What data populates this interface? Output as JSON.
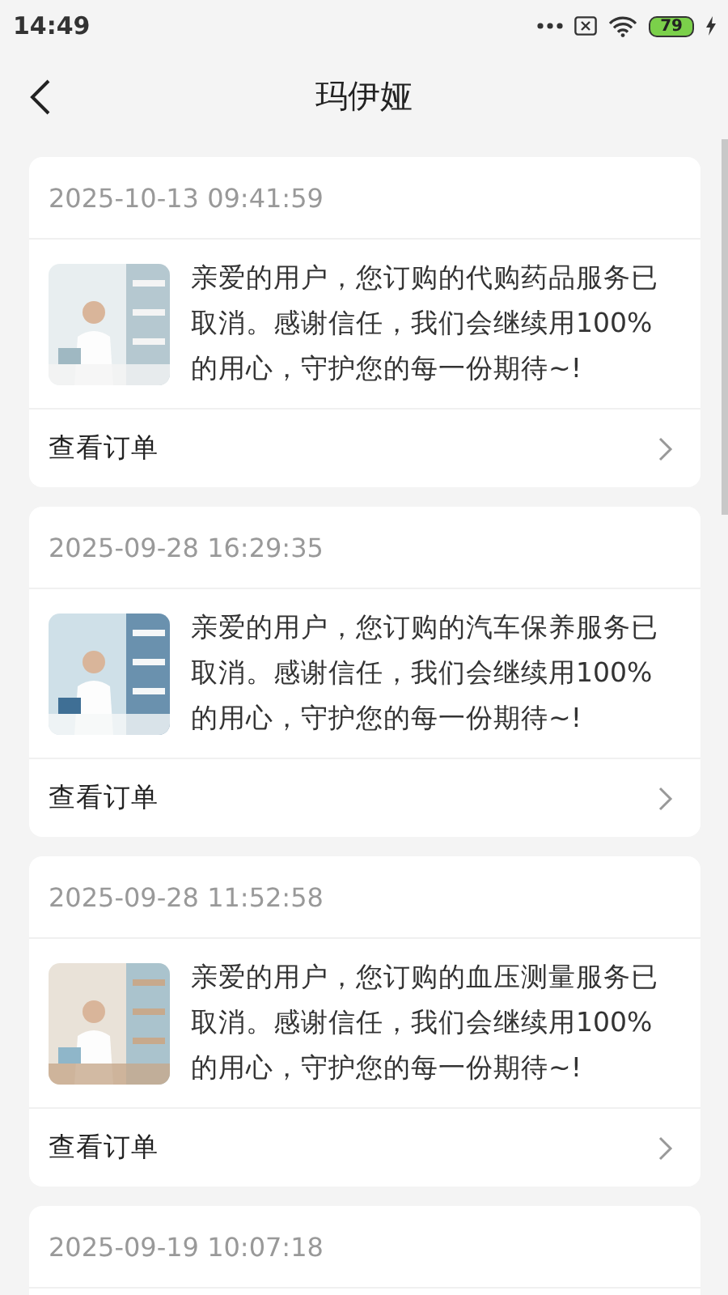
{
  "status_bar": {
    "time": "14:49",
    "battery": "79"
  },
  "header": {
    "title": "玛伊娅"
  },
  "orders": [
    {
      "time": "2025-10-13 09:41:59",
      "message": "亲爱的用户，您订购的代购药品服务已取消。感谢信任，我们会继续用100%的用心，守护您的每一份期待~!",
      "link": "查看订单"
    },
    {
      "time": "2025-09-28 16:29:35",
      "message": "亲爱的用户，您订购的汽车保养服务已取消。感谢信任，我们会继续用100%的用心，守护您的每一份期待~!",
      "link": "查看订单"
    },
    {
      "time": "2025-09-28 11:52:58",
      "message": "亲爱的用户，您订购的血压测量服务已取消。感谢信任，我们会继续用100%的用心，守护您的每一份期待~!",
      "link": "查看订单"
    },
    {
      "time": "2025-09-19 10:07:18"
    }
  ]
}
